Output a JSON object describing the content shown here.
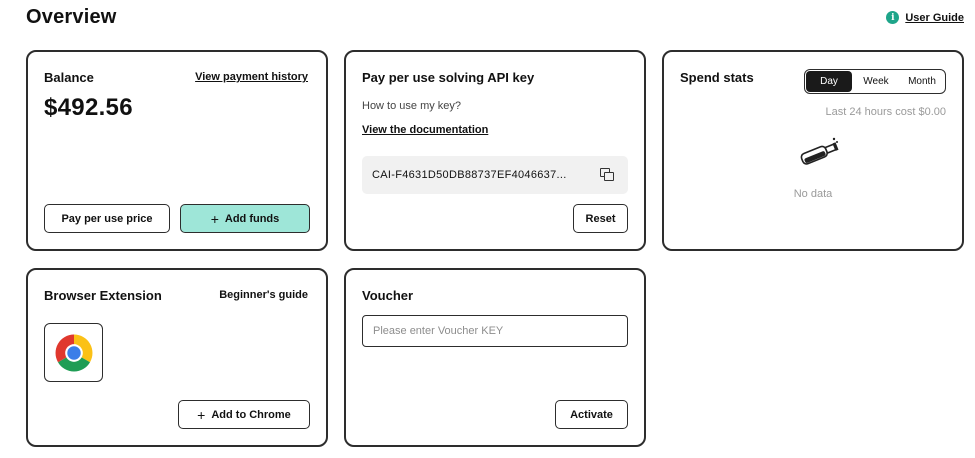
{
  "header": {
    "title": "Overview",
    "guide_link": "User Guide",
    "guide_icon_glyph": "i"
  },
  "balance": {
    "title": "Balance",
    "history_link": "View payment history",
    "amount": "$492.56",
    "pay_price_button": "Pay per use price",
    "add_funds_button": "Add funds"
  },
  "api": {
    "title": "Pay per use solving API key",
    "how_to": "How to use my key?",
    "doc_link": "View the documentation",
    "key_value": "CAI-F4631D50DB88737EF4046637...",
    "reset_button": "Reset"
  },
  "spend": {
    "title": "Spend stats",
    "tabs": [
      "Day",
      "Week",
      "Month"
    ],
    "active_tab": "Day",
    "cost_text": "Last 24 hours cost $0.00",
    "empty_text": "No data"
  },
  "extension": {
    "title": "Browser Extension",
    "guide_link": "Beginner's guide",
    "add_button": "Add to Chrome"
  },
  "voucher": {
    "title": "Voucher",
    "input_placeholder": "Please enter Voucher KEY",
    "input_value": "",
    "activate_button": "Activate"
  },
  "colors": {
    "accent": "#9ee6d8",
    "info_icon": "#1ea58a",
    "border": "#2d2d2d",
    "muted": "#9a9a9a"
  },
  "icons": {
    "guide": "info-icon",
    "copy": "copy-icon",
    "add": "plus-icon",
    "empty_state": "empty-bottle-icon",
    "browser": "chrome-icon"
  }
}
